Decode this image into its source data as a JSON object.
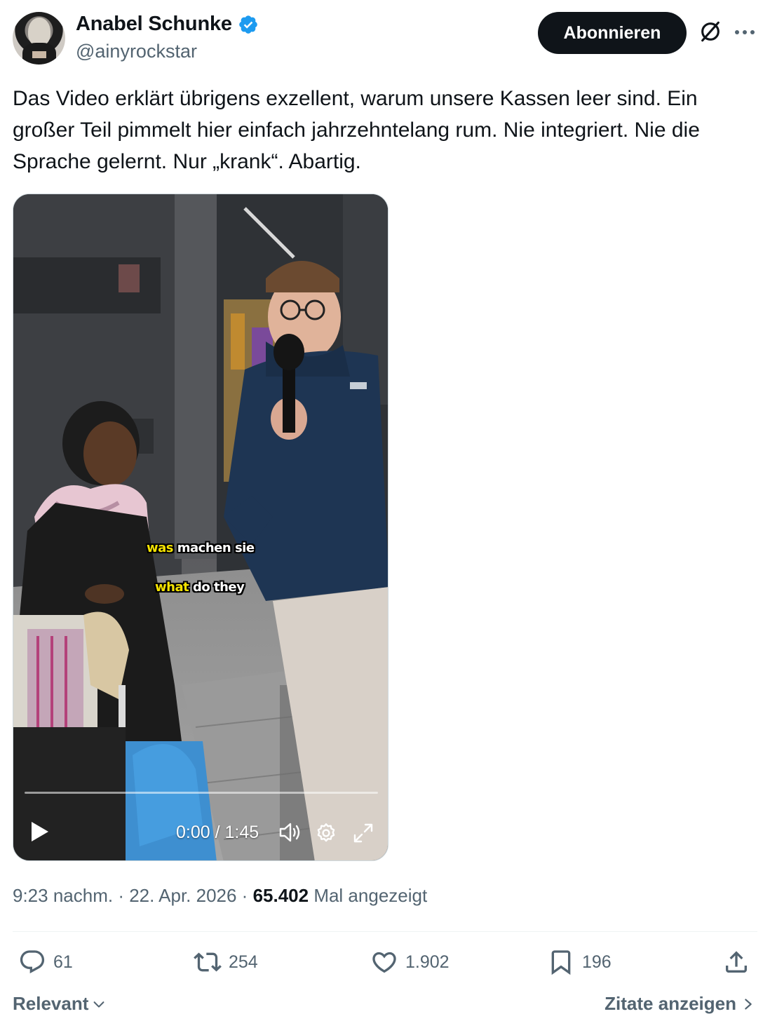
{
  "author": {
    "name": "Anabel Schunke",
    "handle": "@ainyrockstar",
    "verified": true
  },
  "follow_button": {
    "label": "Abonnieren"
  },
  "tweet": {
    "text": "Das Video erklärt übrigens exzellent, warum unsere Kassen leer sind. Ein großer Teil pimmelt hier einfach jahrzehntelang rum. Nie integriert. Nie die Sprache gelernt. Nur „krank“. Abartig."
  },
  "video": {
    "subtitle_top_highlight": "was",
    "subtitle_top_rest": " machen sie",
    "subtitle_bottom_highlight": "what",
    "subtitle_bottom_rest": " do they",
    "time": "0:00 / 1:45",
    "progress": 0.0
  },
  "meta": {
    "time": "9:23 nachm.",
    "sep1": " · ",
    "date": "22. Apr. 2026",
    "sep2": " · ",
    "views": "65.402",
    "views_label": " Mal angezeigt"
  },
  "actions": {
    "replies": "61",
    "reposts": "254",
    "likes": "1.902",
    "bookmarks": "196"
  },
  "footer": {
    "sort_label": "Relevant",
    "quotes_label": "Zitate anzeigen"
  },
  "colors": {
    "accent": "#1d9bf0",
    "text": "#0f1419",
    "muted": "#536471",
    "subtitle_highlight": "#f5e300"
  }
}
